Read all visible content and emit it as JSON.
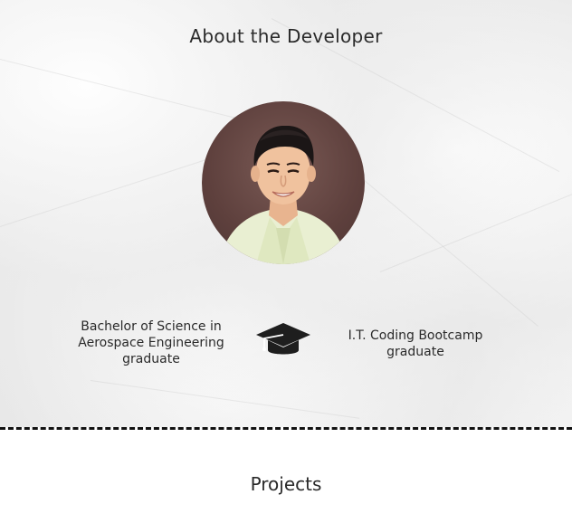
{
  "about": {
    "title": "About the Developer",
    "education_left": "Bachelor of Science in Aerospace Engineering graduate",
    "education_right": "I.T. Coding Bootcamp graduate",
    "education_icon": "graduation-cap-icon"
  },
  "projects": {
    "title": "Projects"
  },
  "colors": {
    "text": "#2a2a2a",
    "divider": "#111111",
    "paper": "#eeeeee",
    "photo_background": "#5e403d"
  }
}
